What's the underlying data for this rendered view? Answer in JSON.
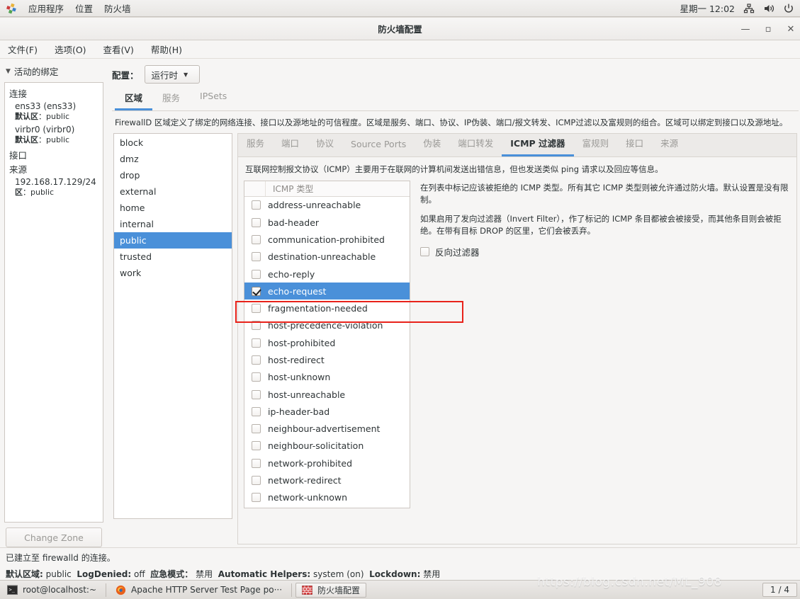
{
  "desktop_panel": {
    "apps_icon": "colorful-squares-icon",
    "items": [
      "应用程序",
      "位置",
      "防火墙"
    ],
    "clock": "星期一 12:02",
    "tray_icons": [
      "network-icon",
      "volume-icon",
      "power-icon"
    ]
  },
  "window": {
    "title": "防火墙配置",
    "minimize_label": "—",
    "maximize_label": "▫",
    "close_label": "✕",
    "menus": [
      "文件(F)",
      "选项(O)",
      "查看(V)",
      "帮助(H)"
    ]
  },
  "left": {
    "bindings_header": "活动的绑定",
    "groups": [
      {
        "title": "连接",
        "entries": [
          {
            "name": "ens33 (ens33)",
            "sub_label": "默认区",
            "sub_value": "public"
          },
          {
            "name": "virbr0 (virbr0)",
            "sub_label": "默认区",
            "sub_value": "public"
          }
        ]
      },
      {
        "title": "接口",
        "entries": []
      },
      {
        "title": "来源",
        "entries": [
          {
            "name": "192.168.17.129/24",
            "sub_label": "区",
            "sub_value": "public"
          }
        ]
      }
    ],
    "change_zone_button": "Change Zone"
  },
  "config": {
    "label": "配置：",
    "selected": "运行时",
    "caret": "▼"
  },
  "top_tabs": [
    {
      "label": "区域",
      "active": true
    },
    {
      "label": "服务",
      "active": false
    },
    {
      "label": "IPSets",
      "active": false
    }
  ],
  "zone_description": "FirewallD 区域定义了绑定的网络连接、接口以及源地址的可信程度。区域是服务、端口、协议、IP伪装、端口/报文转发、ICMP过滤以及富规则的组合。区域可以绑定到接口以及源地址。",
  "zones": [
    {
      "name": "block",
      "selected": false
    },
    {
      "name": "dmz",
      "selected": false
    },
    {
      "name": "drop",
      "selected": false
    },
    {
      "name": "external",
      "selected": false
    },
    {
      "name": "home",
      "selected": false
    },
    {
      "name": "internal",
      "selected": false
    },
    {
      "name": "public",
      "selected": true
    },
    {
      "name": "trusted",
      "selected": false
    },
    {
      "name": "work",
      "selected": false
    }
  ],
  "sub_tabs": [
    {
      "label": "服务",
      "active": false
    },
    {
      "label": "端口",
      "active": false
    },
    {
      "label": "协议",
      "active": false
    },
    {
      "label": "Source Ports",
      "active": false
    },
    {
      "label": "伪装",
      "active": false
    },
    {
      "label": "端口转发",
      "active": false
    },
    {
      "label": "ICMP 过滤器",
      "active": true
    },
    {
      "label": "富规则",
      "active": false
    },
    {
      "label": "接口",
      "active": false
    },
    {
      "label": "来源",
      "active": false
    }
  ],
  "icmp": {
    "intro": "互联网控制报文协议（ICMP）主要用于在联网的计算机间发送出错信息，但也发送类似 ping 请求以及回应等信息。",
    "column_header": "ICMP 类型",
    "paragraph_1": "在列表中标记应该被拒绝的 ICMP 类型。所有其它 ICMP 类型则被允许通过防火墙。默认设置是没有限制。",
    "paragraph_2": "如果启用了发向过滤器（Invert Filter），作了标记的 ICMP 条目都被会被接受，而其他条目则会被拒绝。在带有目标 DROP 的区里，它们会被丢弃。",
    "invert_filter_label": "反向过滤器",
    "invert_filter_checked": false,
    "types": [
      {
        "name": "address-unreachable",
        "checked": false,
        "selected": false
      },
      {
        "name": "bad-header",
        "checked": false,
        "selected": false
      },
      {
        "name": "communication-prohibited",
        "checked": false,
        "selected": false
      },
      {
        "name": "destination-unreachable",
        "checked": false,
        "selected": false
      },
      {
        "name": "echo-reply",
        "checked": false,
        "selected": false
      },
      {
        "name": "echo-request",
        "checked": true,
        "selected": true
      },
      {
        "name": "fragmentation-needed",
        "checked": false,
        "selected": false
      },
      {
        "name": "host-precedence-violation",
        "checked": false,
        "selected": false
      },
      {
        "name": "host-prohibited",
        "checked": false,
        "selected": false
      },
      {
        "name": "host-redirect",
        "checked": false,
        "selected": false
      },
      {
        "name": "host-unknown",
        "checked": false,
        "selected": false
      },
      {
        "name": "host-unreachable",
        "checked": false,
        "selected": false
      },
      {
        "name": "ip-header-bad",
        "checked": false,
        "selected": false
      },
      {
        "name": "neighbour-advertisement",
        "checked": false,
        "selected": false
      },
      {
        "name": "neighbour-solicitation",
        "checked": false,
        "selected": false
      },
      {
        "name": "network-prohibited",
        "checked": false,
        "selected": false
      },
      {
        "name": "network-redirect",
        "checked": false,
        "selected": false
      },
      {
        "name": "network-unknown",
        "checked": false,
        "selected": false
      }
    ]
  },
  "statusbar": {
    "connection_line": "已建立至 firewalld 的连接。",
    "fields": [
      {
        "label": "默认区域:",
        "value": "public"
      },
      {
        "label": "LogDenied:",
        "value": "off"
      },
      {
        "label": "应急模式：",
        "value": "禁用"
      },
      {
        "label": "Automatic Helpers:",
        "value": "system (on)"
      },
      {
        "label": "Lockdown:",
        "value": "禁用"
      }
    ]
  },
  "taskbar": {
    "items": [
      {
        "icon": "terminal-icon",
        "label": "root@localhost:~",
        "active": false
      },
      {
        "icon": "firefox-icon",
        "label": "Apache HTTP Server Test Page po···",
        "active": false
      },
      {
        "icon": "firewall-icon",
        "label": "防火墙配置",
        "active": true
      }
    ],
    "workspace": "1 / 4"
  },
  "watermark": "https://blog.csdn.net/ML_908",
  "colors": {
    "accent": "#4a90d9",
    "annotation": "#e8221a",
    "panel_bg": "#f6f5f4",
    "text": "#2e3436",
    "muted_text": "#9a9996"
  }
}
